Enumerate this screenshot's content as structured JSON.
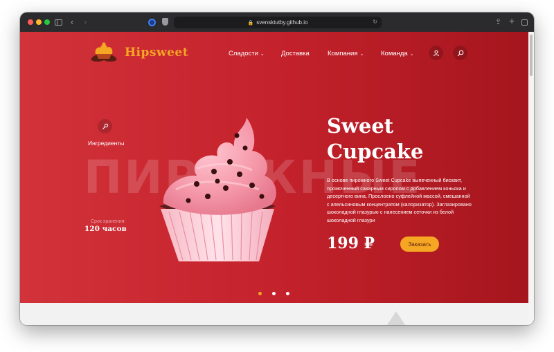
{
  "browser": {
    "url": "svensktutby.github.io"
  },
  "header": {
    "logo_text": "Hipsweet",
    "menu": [
      {
        "label": "Сладости",
        "has_dropdown": true
      },
      {
        "label": "Доставка",
        "has_dropdown": false
      },
      {
        "label": "Компания",
        "has_dropdown": true
      },
      {
        "label": "Команда",
        "has_dropdown": true
      }
    ],
    "icons": [
      "user-icon",
      "search-icon"
    ]
  },
  "hero": {
    "background_word": "ПИРОЖНЫЕ",
    "ingredients_label": "Ингредиенты",
    "shelf_life_label": "Срок хранения:",
    "shelf_life_value": "120 часов",
    "product_title": "Sweet Cupcake",
    "product_description": "В основе пирожного Sweet Cupcake выпеченный бисквит, промоченный сахарным сиропом с добавлением коньяка и десертного вина. Прослоено суфлейной массой, смешанной с апельсиновым концентратом (калоризатор). Заглазировано шоколадной глазурью с нанесением сеточки из белой шоколадной глазури",
    "price": "199 ₽",
    "order_button": "Заказать",
    "slider": {
      "count": 3,
      "active_index": 0
    }
  },
  "colors": {
    "hero_red": "#c4222c",
    "accent_orange": "#f5a623",
    "white": "#ffffff"
  }
}
